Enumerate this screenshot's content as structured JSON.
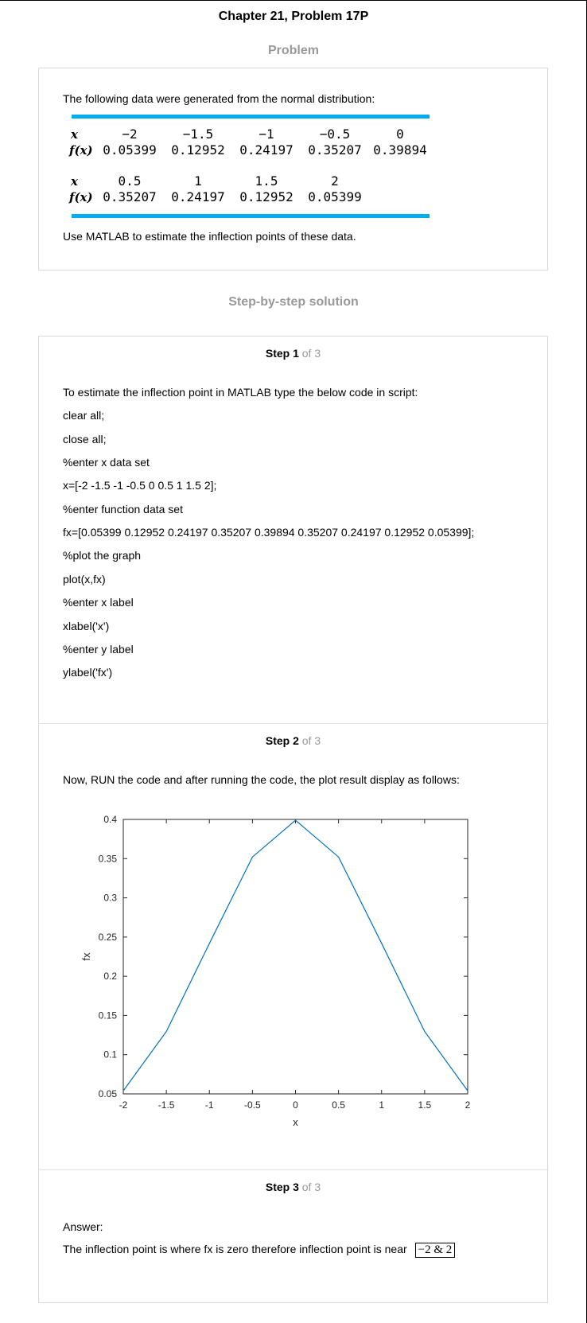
{
  "title": "Chapter 21, Problem 17P",
  "problem": {
    "heading": "Problem",
    "intro": "The following data were generated from the normal distribution:",
    "table": {
      "x_label": "x",
      "fx_label": "f(x)",
      "row1_x": [
        "−2",
        "−1.5",
        "−1",
        "−0.5",
        "0"
      ],
      "row1_fx": [
        "0.05399",
        "0.12952",
        "0.24197",
        "0.35207",
        "0.39894"
      ],
      "row2_x": [
        "0.5",
        "1",
        "1.5",
        "2"
      ],
      "row2_fx": [
        "0.35207",
        "0.24197",
        "0.12952",
        "0.05399"
      ],
      "rule_color": "#00aeef"
    },
    "question": "Use MATLAB to estimate the inflection points of these data."
  },
  "solution_heading": "Step-by-step solution",
  "steps": [
    {
      "label": "Step 1",
      "of": "of 3",
      "lines": [
        "To estimate the inflection point in MATLAB type the below code in script:",
        "clear all;",
        "close all;",
        "%enter x data set",
        "x=[-2 -1.5 -1 -0.5 0 0.5 1 1.5 2];",
        "%enter function data set",
        "fx=[0.05399 0.12952 0.24197 0.35207 0.39894 0.35207 0.24197 0.12952 0.05399];",
        "%plot the graph",
        "plot(x,fx)",
        "%enter x label",
        "xlabel('x')",
        "%enter y label",
        "ylabel('fx')"
      ]
    },
    {
      "label": "Step 2",
      "of": "of 3",
      "text": "Now, RUN the code and after running the code, the plot result display as follows:"
    },
    {
      "label": "Step 3",
      "of": "of 3",
      "answer_label": "Answer:",
      "answer_text": "The inflection point is where fx is zero therefore inflection point is near",
      "answer_box": "−2 & 2"
    }
  ],
  "chart_data": {
    "type": "line",
    "x": [
      -2,
      -1.5,
      -1,
      -0.5,
      0,
      0.5,
      1,
      1.5,
      2
    ],
    "y": [
      0.05399,
      0.12952,
      0.24197,
      0.35207,
      0.39894,
      0.35207,
      0.24197,
      0.12952,
      0.05399
    ],
    "xlabel": "x",
    "ylabel": "fx",
    "xlim": [
      -2,
      2
    ],
    "ylim": [
      0.05,
      0.4
    ],
    "xticks": [
      "-2",
      "-1.5",
      "-1",
      "-0.5",
      "0",
      "0.5",
      "1",
      "1.5",
      "2"
    ],
    "yticks": [
      "0.05",
      "0.1",
      "0.15",
      "0.2",
      "0.25",
      "0.3",
      "0.35",
      "0.4"
    ],
    "line_color": "#0072bd",
    "grid": false
  }
}
